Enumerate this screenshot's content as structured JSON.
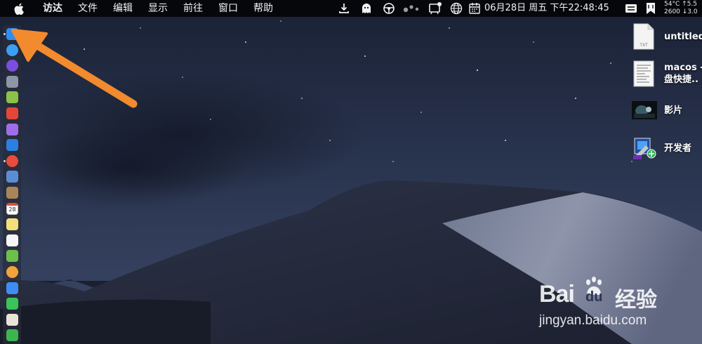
{
  "menubar": {
    "items": [
      "访达",
      "文件",
      "编辑",
      "显示",
      "前往",
      "窗口",
      "帮助"
    ],
    "clock": "06月28日 周五 下午22:48:45",
    "stats": {
      "line1": "54°C ↑5.5",
      "line2": "2600 ↓3.0"
    }
  },
  "status_icons": [
    "download-icon",
    "ghost-icon",
    "steering-wheel-icon",
    "dots-icon",
    "notification-icon",
    "globe-icon",
    "calendar-icon",
    "input-switch-icon",
    "bookmark-icon"
  ],
  "dock": {
    "icons": [
      {
        "name": "finder-icon",
        "color": "#2f8df0",
        "running": true
      },
      {
        "name": "safari-icon",
        "color": "#3aa0f5",
        "running": false
      },
      {
        "name": "siri-icon",
        "color": "#7a4ee0",
        "running": false
      },
      {
        "name": "launchpad-icon",
        "color": "#8d96a6",
        "running": false
      },
      {
        "name": "android-icon",
        "color": "#8bc34a",
        "running": false
      },
      {
        "name": "app-store-icon",
        "color": "#e5463a",
        "running": false
      },
      {
        "name": "disk-utility-icon",
        "color": "#9d6ee8",
        "running": false
      },
      {
        "name": "xcode-icon",
        "color": "#2b7fe0",
        "running": false
      },
      {
        "name": "chrome-icon",
        "color": "#e94b3c",
        "running": true
      },
      {
        "name": "preview-icon",
        "color": "#5b8dd6",
        "running": false
      },
      {
        "name": "notebook-icon",
        "color": "#a8865a",
        "running": false
      },
      {
        "name": "calendar-icon",
        "color": "#ffffff",
        "running": false
      },
      {
        "name": "notes-icon",
        "color": "#f4e07a",
        "running": false
      },
      {
        "name": "reminders-icon",
        "color": "#f6f6f6",
        "running": false
      },
      {
        "name": "maps-icon",
        "color": "#6cc04a",
        "running": false
      },
      {
        "name": "photos-icon",
        "color": "#f2a33a",
        "running": false
      },
      {
        "name": "messages-icon",
        "color": "#3d8df5",
        "running": false
      },
      {
        "name": "facetime-icon",
        "color": "#3ac45a",
        "running": false
      },
      {
        "name": "textedit-icon",
        "color": "#e8e4d8",
        "running": false
      },
      {
        "name": "numbers-icon",
        "color": "#3cb550",
        "running": false
      }
    ],
    "calendar_date": "28"
  },
  "desktop_items": [
    {
      "name": "desktop-file-untitled",
      "icon": "txt-file-icon",
      "label_line1": "untitled",
      "label_line2": "",
      "badge": "TXT"
    },
    {
      "name": "desktop-file-macos",
      "icon": "document-thumbnail-icon",
      "label_line1": "macos -",
      "label_line2": "盘快捷..",
      "badge": ""
    },
    {
      "name": "desktop-folder-movies",
      "icon": "movie-thumbnail-icon",
      "label_line1": "影片",
      "label_line2": "",
      "badge": ""
    },
    {
      "name": "desktop-folder-developer",
      "icon": "developer-icon",
      "label_line1": "开发者",
      "label_line2": "",
      "badge": ""
    }
  ],
  "watermark": {
    "brand_left": "Bai",
    "brand_mid": "du",
    "brand_right": "经验",
    "url": "jingyan.baidu.com"
  },
  "colors": {
    "annotation_arrow": "#f28a2e",
    "menubar": "#06070b"
  }
}
